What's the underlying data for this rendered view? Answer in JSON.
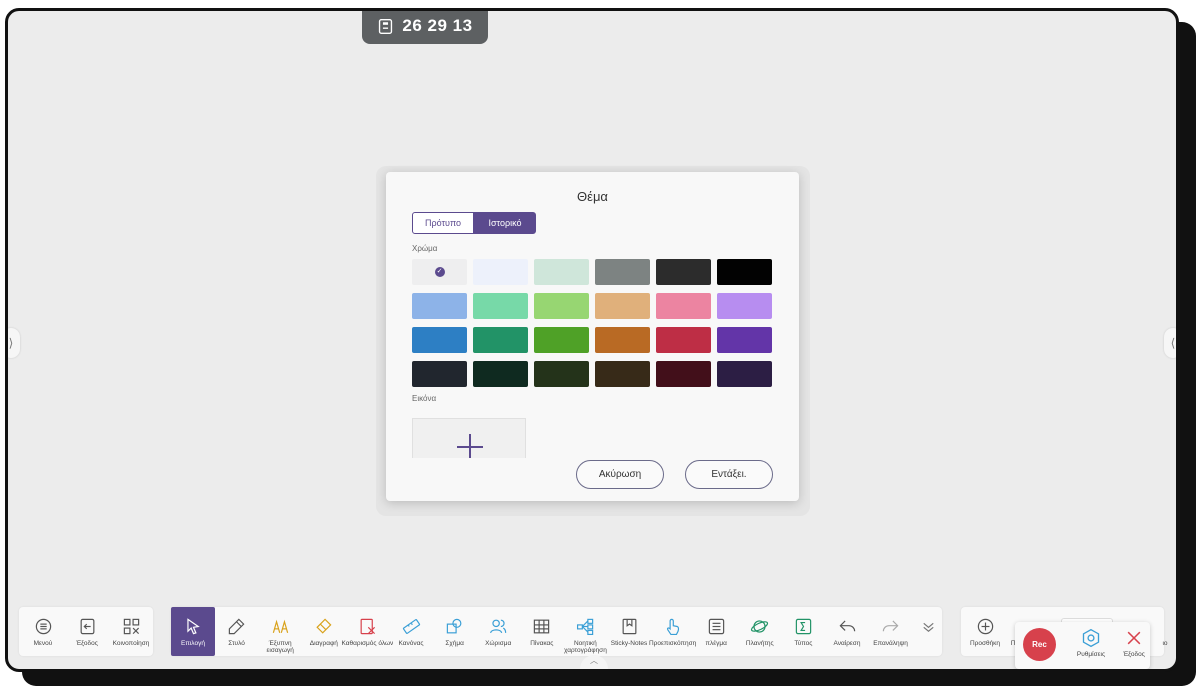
{
  "timer": {
    "value": "26 29 13",
    "icon": "timer-device-icon"
  },
  "edges": {
    "left": "⟩",
    "right": "⟨"
  },
  "dialog": {
    "title": "Θέμα",
    "tabs": [
      "Πρότυπο",
      "Ιστορικό"
    ],
    "active_tab": "Ιστορικό",
    "color_label": "Χρώμα",
    "image_label": "Εικόνα",
    "selected_swatch": 0,
    "swatches": [
      "#eeeeef",
      "#edf1fb",
      "#cfe6da",
      "#7d8382",
      "#2c2c2c",
      "#020202",
      "#8db3e8",
      "#77d9a8",
      "#97d672",
      "#e0b07b",
      "#ec84a1",
      "#b78df0",
      "#2d7fc4",
      "#229367",
      "#4fa127",
      "#b96a24",
      "#be2e45",
      "#6335a8",
      "#21262e",
      "#0f2a20",
      "#24331a",
      "#372a18",
      "#420f1a",
      "#2c1e44"
    ],
    "cancel": "Ακύρωση",
    "ok": "Εντάξει."
  },
  "toolbar_left": [
    {
      "label": "Μενού",
      "icon": "menu-icon"
    },
    {
      "label": "Έξοδος",
      "icon": "exit-icon"
    },
    {
      "label": "Κοινοποίηση",
      "icon": "qr-share-icon"
    }
  ],
  "toolbar_main": [
    {
      "label": "Επιλογή",
      "icon": "select-cursor-icon"
    },
    {
      "label": "Στυλό",
      "icon": "pen-icon"
    },
    {
      "label": "Έξυπνη εισαγωγή",
      "icon": "smart-input-icon"
    },
    {
      "label": "Διαγραφή",
      "icon": "eraser-icon"
    },
    {
      "label": "Καθαρισμός όλων",
      "icon": "clear-all-icon"
    },
    {
      "label": "Κανόνας",
      "icon": "ruler-icon"
    },
    {
      "label": "Σχήμα",
      "icon": "shape-icon"
    },
    {
      "label": "Χώρισμα",
      "icon": "split-users-icon"
    },
    {
      "label": "Πίνακας",
      "icon": "table-icon"
    },
    {
      "label": "Νοητική χαρτογράφηση",
      "icon": "mind-map-icon"
    },
    {
      "label": "Sticky-Notes",
      "icon": "sticky-note-icon"
    },
    {
      "label": "Προεπισκόπηση",
      "icon": "preview-touch-icon"
    },
    {
      "label": "πλέγμα",
      "icon": "grid-list-icon"
    },
    {
      "label": "Πλανήτης",
      "icon": "planet-icon"
    },
    {
      "label": "Τύπος",
      "icon": "formula-icon"
    },
    {
      "label": "Αναίρεση",
      "icon": "undo-icon"
    },
    {
      "label": "Επανάληψη",
      "icon": "redo-icon"
    }
  ],
  "toolbar_right": [
    {
      "label": "Προσθήκη",
      "icon": "add-page-icon"
    },
    {
      "label": "Πρ",
      "icon": ""
    },
    {
      "label": "ιο",
      "icon": ""
    }
  ],
  "overlay": {
    "rec": "Rec",
    "settings": "Ρυθμίσεις",
    "exit": "Έξοδος"
  },
  "colors": {
    "accent": "#5b4a8e",
    "rec": "#d7414c"
  }
}
